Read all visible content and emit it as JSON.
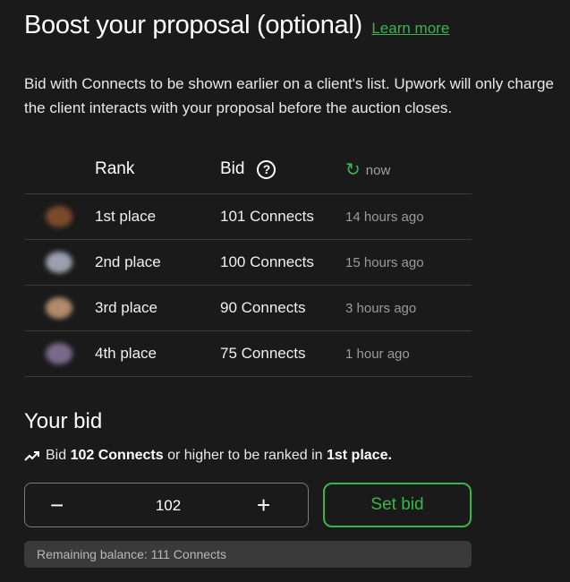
{
  "header": {
    "title": "Boost your proposal (optional)",
    "learn_more": "Learn more"
  },
  "description": {
    "line1": "Bid with Connects to be shown earlier on a client's list. Upwork will only charge",
    "line2": "the client interacts with your proposal before the auction closes."
  },
  "table": {
    "headers": {
      "rank": "Rank",
      "bid": "Bid",
      "help_icon": "?",
      "refresh_icon": "refresh-icon",
      "refresh_label": "now"
    },
    "rows": [
      {
        "rank": "1st place",
        "bid": "101 Connects",
        "time": "14 hours ago",
        "avatar_color": "#7a4a2a"
      },
      {
        "rank": "2nd place",
        "bid": "100 Connects",
        "time": "15 hours ago",
        "avatar_color": "#9aa0b0"
      },
      {
        "rank": "3rd place",
        "bid": "90 Connects",
        "time": "3 hours ago",
        "avatar_color": "#b08a6a"
      },
      {
        "rank": "4th place",
        "bid": "75 Connects",
        "time": "1 hour ago",
        "avatar_color": "#7a6a8a"
      }
    ]
  },
  "your_bid": {
    "heading": "Your bid",
    "hint_prefix": "Bid",
    "hint_amount": "102 Connects",
    "hint_middle": "or higher to be ranked in",
    "hint_place": "1st place.",
    "value": "102",
    "minus": "−",
    "plus": "+",
    "set_bid_label": "Set bid",
    "balance": "Remaining balance: 111 Connects"
  },
  "colors": {
    "accent": "#3ab54a",
    "background": "#1a1a1a"
  }
}
